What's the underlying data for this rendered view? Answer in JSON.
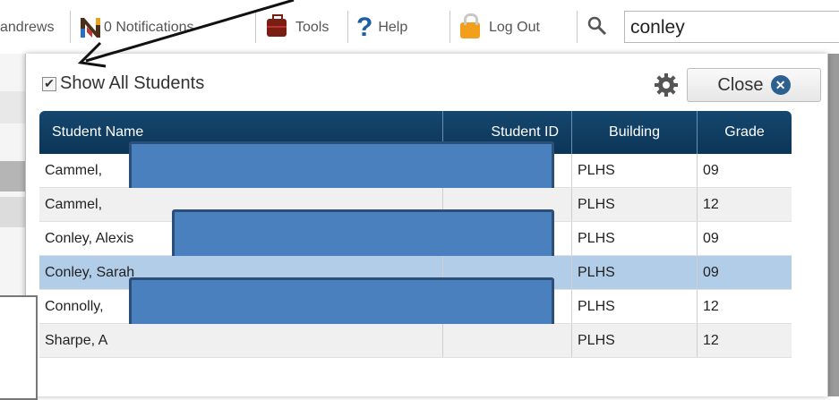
{
  "toolbar": {
    "user_fragment": "andrews",
    "notifications_label": "0 Notifications",
    "tools_label": "Tools",
    "help_label": "Help",
    "logout_label": "Log Out",
    "search_value": "conley"
  },
  "modal": {
    "show_all_label": "Show All Students",
    "show_all_checked": true,
    "close_label": "Close",
    "columns": [
      "Student Name",
      "Student ID",
      "Building",
      "Grade"
    ],
    "rows": [
      {
        "name": "Cammel,",
        "building": "PLHS",
        "grade": "09"
      },
      {
        "name": "Cammel,",
        "building": "PLHS",
        "grade": "12"
      },
      {
        "name": "Conley, Alexis",
        "building": "PLHS",
        "grade": "09"
      },
      {
        "name": "Conley, Sarah",
        "building": "PLHS",
        "grade": "09"
      },
      {
        "name": "Connolly,",
        "building": "PLHS",
        "grade": "12"
      },
      {
        "name": "Sharpe, A",
        "building": "PLHS",
        "grade": "12"
      }
    ],
    "selected_row_index": 3
  },
  "colors": {
    "header_bg": "#0f3d63",
    "selected_row": "#b2cde8",
    "redaction": "#4a80bd",
    "accent": "#2d5f8f"
  },
  "icons": [
    "notifications-icon",
    "tools-icon",
    "help-icon",
    "lock-icon",
    "search-icon",
    "gear-icon",
    "close-icon",
    "annotation-arrow"
  ]
}
